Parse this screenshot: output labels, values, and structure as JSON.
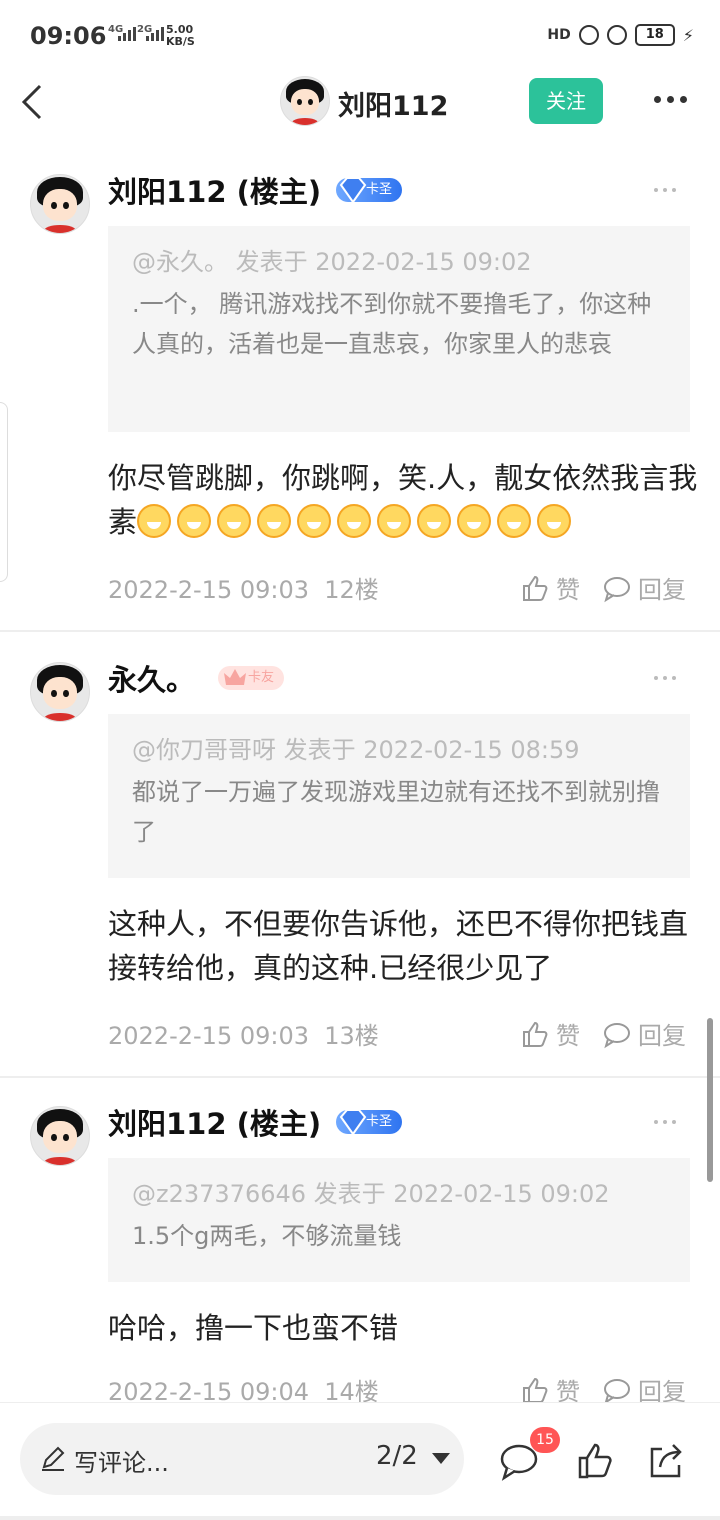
{
  "status_bar": {
    "time": "09:06",
    "net1": "4G",
    "net2": "2G",
    "speed_value": "5.00",
    "speed_unit": "KB/S",
    "hd": "HD",
    "battery": "18"
  },
  "header": {
    "name": "刘阳112",
    "follow_label": "关注"
  },
  "posts": [
    {
      "author": "刘阳112 (楼主)",
      "badge": "卡圣",
      "quote_meta": "@永久。 发表于 2022-02-15 09:02",
      "quote_text": ".一个， 腾讯游戏找不到你就不要撸毛了，你这种人真的，活着也是一直悲哀，你家里人的悲哀",
      "content": "你尽管跳脚，你跳啊，笑.人，靓女依然我言我素",
      "date": "2022-2-15 09:03",
      "floor": "12楼",
      "like_label": "赞",
      "reply_label": "回复"
    },
    {
      "author": "永久。",
      "badge": "卡友",
      "quote_meta": "@你刀哥哥呀 发表于 2022-02-15 08:59",
      "quote_text": "都说了一万遍了发现游戏里边就有还找不到就别撸了",
      "content": "这种人，不但要你告诉他，还巴不得你把钱直接转给他，真的这种.已经很少见了",
      "date": "2022-2-15 09:03",
      "floor": "13楼",
      "like_label": "赞",
      "reply_label": "回复"
    },
    {
      "author": "刘阳112 (楼主)",
      "badge": "卡圣",
      "quote_meta": "@z237376646 发表于 2022-02-15 09:02",
      "quote_text": "1.5个g两毛，不够流量钱",
      "content": "哈哈，撸一下也蛮不错",
      "date": "2022-2-15 09:04",
      "floor": "14楼",
      "like_label": "赞",
      "reply_label": "回复"
    }
  ],
  "bottom_bar": {
    "compose_placeholder": "写评论...",
    "page_indicator": "2/2",
    "comment_count": "15"
  },
  "colors": {
    "accent": "#2cc29a",
    "badge_blue": "#2f74f0",
    "badge_pink": "#ffe3e0",
    "count_red": "#ff5555"
  }
}
